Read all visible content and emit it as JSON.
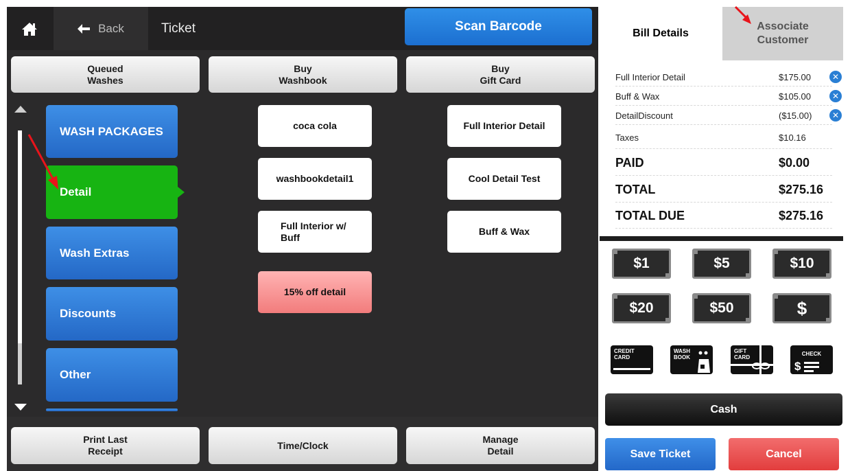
{
  "header": {
    "back_label": "Back",
    "title": "Ticket",
    "scan_label": "Scan Barcode"
  },
  "actions_top": {
    "queued_washes": "Queued\nWashes",
    "buy_washbook": "Buy\nWashbook",
    "buy_gift_card": "Buy\nGift Card"
  },
  "categories": [
    {
      "label": "WASH PACKAGES",
      "selected": false
    },
    {
      "label": "Detail",
      "selected": true
    },
    {
      "label": "Wash Extras",
      "selected": false
    },
    {
      "label": "Discounts",
      "selected": false
    },
    {
      "label": "Other",
      "selected": false
    }
  ],
  "items": {
    "col1": [
      "coca cola",
      "washbookdetail1",
      "Full Interior w/\nBuff",
      "15% off detail"
    ],
    "col2": [
      "Full Interior Detail",
      "Cool Detail Test",
      "Buff & Wax"
    ]
  },
  "actions_bottom": {
    "print_last_receipt": "Print Last\nReceipt",
    "time_clock": "Time/Clock",
    "manage_detail": "Manage\nDetail"
  },
  "bill": {
    "tab_bill_details": "Bill Details",
    "tab_associate_customer": "Associate\nCustomer",
    "lines": [
      {
        "label": "Full Interior Detail",
        "amount": "$175.00"
      },
      {
        "label": "Buff & Wax",
        "amount": "$105.00"
      },
      {
        "label": "DetailDiscount",
        "amount": "($15.00)"
      }
    ],
    "taxes_label": "Taxes",
    "taxes_amount": "$10.16",
    "paid_label": "PAID",
    "paid_amount": "$0.00",
    "total_label": "TOTAL",
    "total_amount": "$275.16",
    "total_due_label": "TOTAL DUE",
    "total_due_amount": "$275.16"
  },
  "cash_bills": [
    "$1",
    "$5",
    "$10",
    "$20",
    "$50",
    "$"
  ],
  "tender_cards": {
    "credit": "CREDIT\nCARD",
    "washbook": "WASH\nBOOK",
    "gift": "GIFT\nCARD",
    "check": "CHECK"
  },
  "footer": {
    "cash_label": "Cash",
    "save_label": "Save Ticket",
    "cancel_label": "Cancel"
  },
  "colors": {
    "accent_blue": "#2a7fd4",
    "selected_green": "#17b412",
    "cancel_red": "#e23d3d",
    "annotation_red": "#e8141b"
  },
  "icons": [
    "home-icon",
    "back-arrow-icon",
    "scroll-up-icon",
    "scroll-down-icon",
    "remove-item-icon",
    "dollar-bill-icon",
    "credit-card-icon",
    "washbook-icon",
    "gift-card-icon",
    "check-icon",
    "annotation-arrow-icon"
  ]
}
